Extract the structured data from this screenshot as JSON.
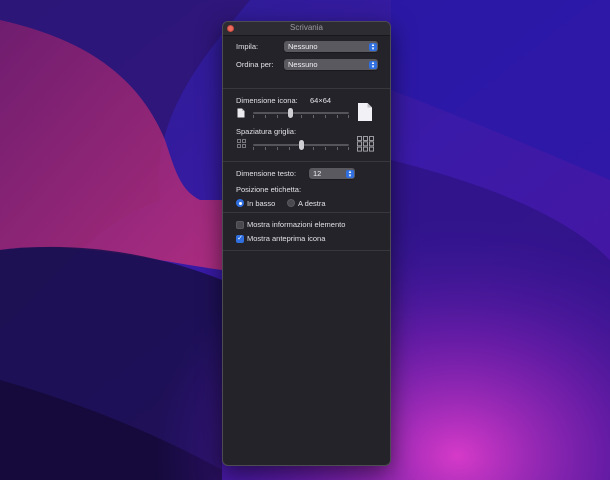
{
  "window": {
    "title": "Scrivania"
  },
  "stack_by": {
    "label": "Impila:",
    "value": "Nessuno"
  },
  "sort_by": {
    "label": "Ordina per:",
    "value": "Nessuno"
  },
  "icon_size": {
    "label": "Dimensione icona:",
    "value": "64×64",
    "level": 0.38
  },
  "grid_spacing": {
    "label": "Spaziatura griglia:",
    "level": 0.5
  },
  "text_size": {
    "label": "Dimensione testo:",
    "value": "12"
  },
  "label_position": {
    "label": "Posizione etichetta:",
    "options": [
      {
        "label": "In basso",
        "selected": true
      },
      {
        "label": "A destra",
        "selected": false
      }
    ]
  },
  "show_item_info": {
    "label": "Mostra informazioni elemento",
    "checked": false
  },
  "show_icon_preview": {
    "label": "Mostra anteprima icona",
    "checked": true
  },
  "icons": {
    "close": "close-icon",
    "popup_arrows": "chevron-up-down-icon",
    "small_doc": "document-small-icon",
    "large_doc": "document-large-icon",
    "small_grid": "grid-small-icon",
    "large_grid": "grid-large-icon",
    "checkmark": "checkmark-icon"
  },
  "colors": {
    "accent": "#2f6fe0",
    "close": "#ed6a5e",
    "panel": "#242329"
  }
}
